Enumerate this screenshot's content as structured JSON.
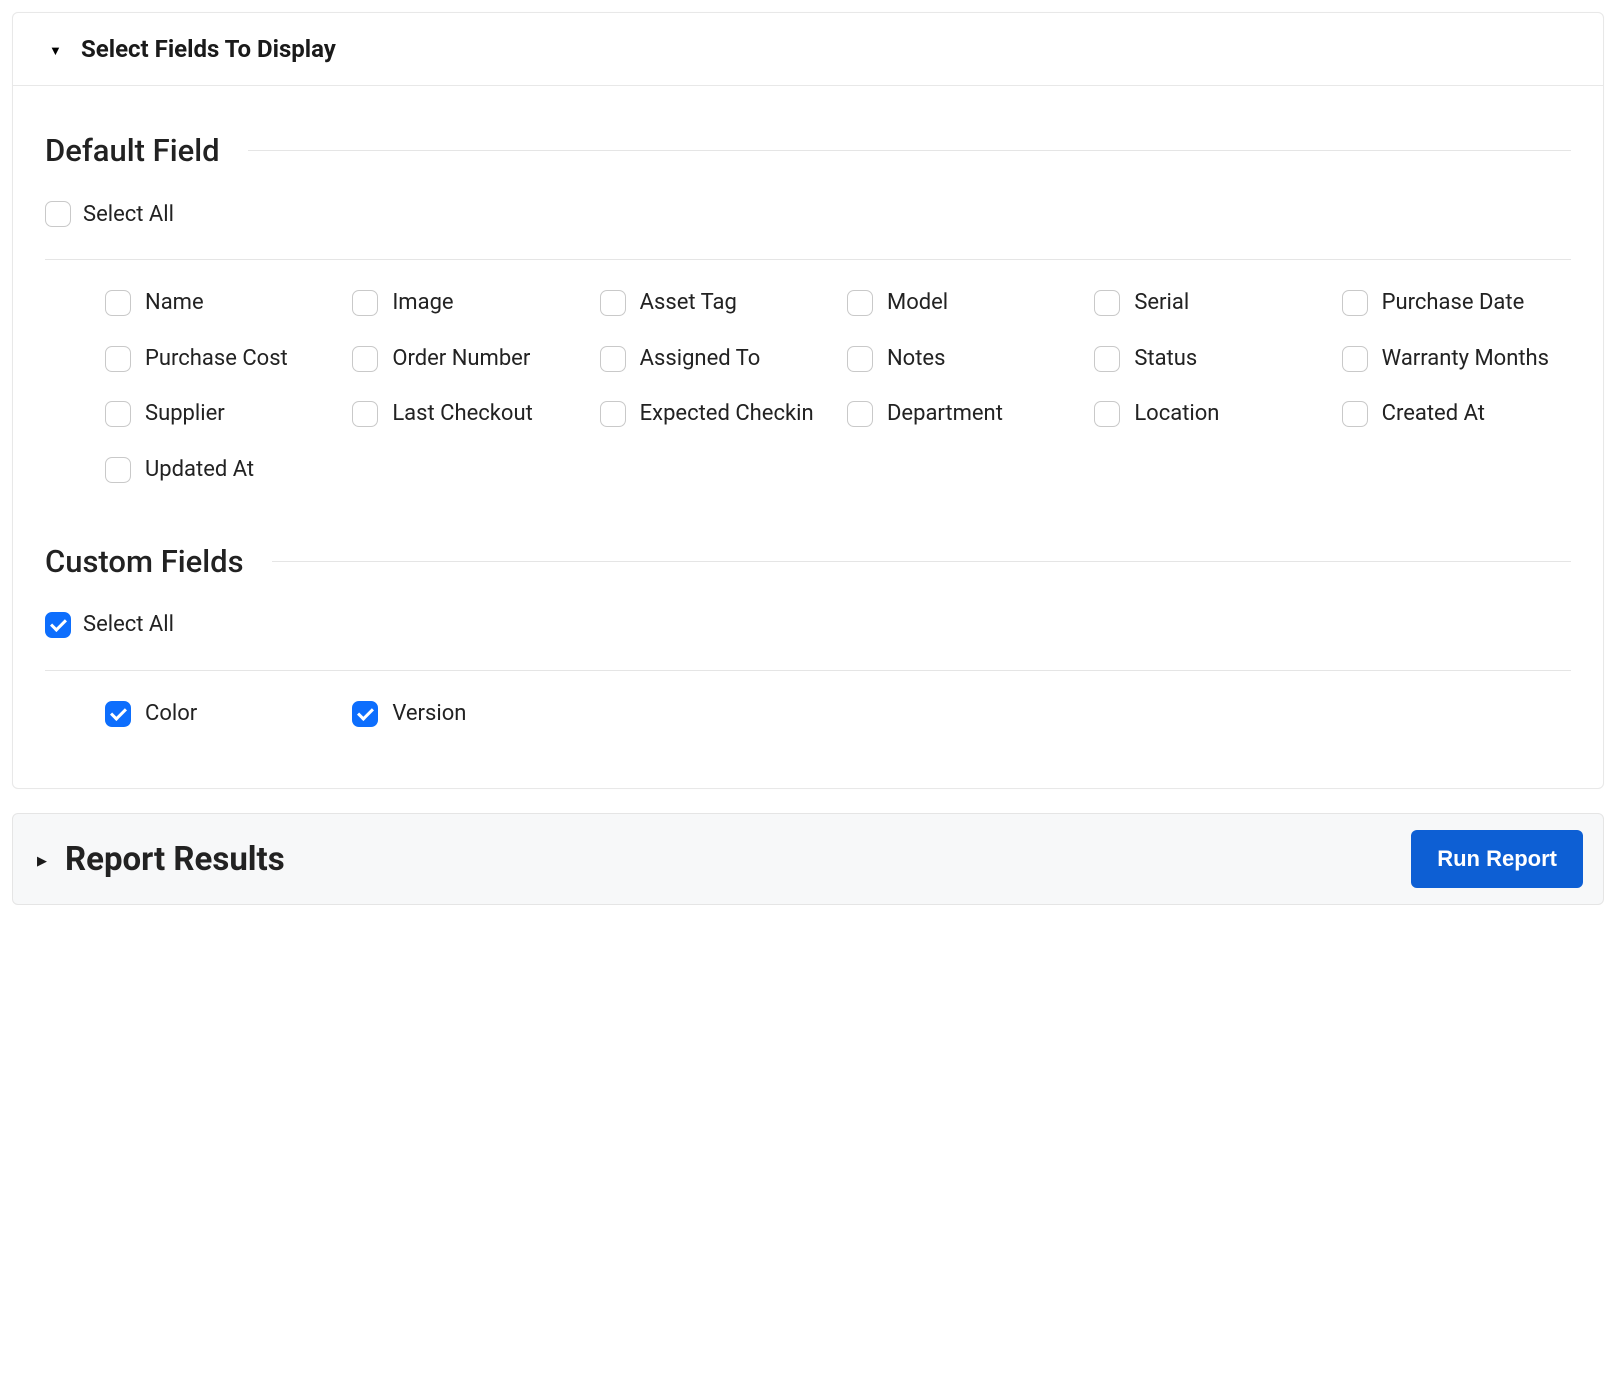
{
  "fieldsPanel": {
    "title": "Select Fields To Display",
    "expanded": true
  },
  "defaultFields": {
    "heading": "Default Field",
    "selectAllLabel": "Select All",
    "selectAllChecked": false,
    "items": [
      {
        "label": "Name",
        "checked": false
      },
      {
        "label": "Image",
        "checked": false
      },
      {
        "label": "Asset Tag",
        "checked": false
      },
      {
        "label": "Model",
        "checked": false
      },
      {
        "label": "Serial",
        "checked": false
      },
      {
        "label": "Purchase Date",
        "checked": false
      },
      {
        "label": "Purchase Cost",
        "checked": false
      },
      {
        "label": "Order Number",
        "checked": false
      },
      {
        "label": "Assigned To",
        "checked": false
      },
      {
        "label": "Notes",
        "checked": false
      },
      {
        "label": "Status",
        "checked": false
      },
      {
        "label": "Warranty Months",
        "checked": false
      },
      {
        "label": "Supplier",
        "checked": false
      },
      {
        "label": "Last Checkout",
        "checked": false
      },
      {
        "label": "Expected Checkin",
        "checked": false
      },
      {
        "label": "Department",
        "checked": false
      },
      {
        "label": "Location",
        "checked": false
      },
      {
        "label": "Created At",
        "checked": false
      },
      {
        "label": "Updated At",
        "checked": false
      }
    ]
  },
  "customFields": {
    "heading": "Custom Fields",
    "selectAllLabel": "Select All",
    "selectAllChecked": true,
    "items": [
      {
        "label": "Color",
        "checked": true
      },
      {
        "label": "Version",
        "checked": true
      }
    ]
  },
  "resultsPanel": {
    "title": "Report Results",
    "expanded": false,
    "runLabel": "Run Report"
  }
}
